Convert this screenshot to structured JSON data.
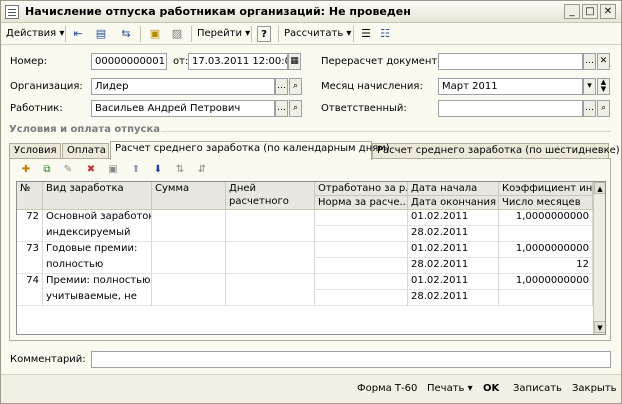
{
  "window": {
    "title": "Начисление отпуска работникам организаций: Не проведен"
  },
  "toolbar": {
    "actions_label": "Действия",
    "goto_label": "Перейти",
    "help_label": "?",
    "calculate_label": "Рассчитать"
  },
  "form": {
    "number_label": "Номер:",
    "number_value": "00000000001",
    "from_label": "от:",
    "date_value": "17.03.2011 12:00:00",
    "recalc_label": "Перерасчет документа:",
    "recalc_value": "",
    "org_label": "Организация:",
    "org_value": "Лидер",
    "month_label": "Месяц начисления:",
    "month_value": "Март 2011",
    "employee_label": "Работник:",
    "employee_value": "Васильев Андрей Петрович",
    "responsible_label": "Ответственный:",
    "responsible_value": "",
    "comment_label": "Комментарий:",
    "comment_value": ""
  },
  "section_title": "Условия и оплата отпуска",
  "tabs": [
    {
      "label": "Условия"
    },
    {
      "label": "Оплата"
    },
    {
      "label": "Расчет среднего заработка (по календарным дням)"
    },
    {
      "label": "Расчет среднего заработка (по шестидневке)"
    }
  ],
  "grid": {
    "columns": {
      "n": "№",
      "type": "Вид заработка",
      "sum": "Сумма",
      "days": "Дней расчетного периода",
      "worked": "Отработано за р...",
      "norm": "Норма за расче...",
      "start": "Дата начала",
      "end": "Дата окончания",
      "coef": "Коэффициент ин...",
      "months": "Число месяцев"
    },
    "rows": [
      {
        "n": "72",
        "type1": "Основной заработок:",
        "type2": "индексируемый",
        "start": "01.02.2011",
        "end": "28.02.2011",
        "coef": "1,0000000000",
        "months": ""
      },
      {
        "n": "73",
        "type1": "Годовые премии:",
        "type2": "полностью",
        "start": "01.02.2011",
        "end": "28.02.2011",
        "coef": "1,0000000000",
        "months": "12"
      },
      {
        "n": "74",
        "type1": "Премии: полностью",
        "type2": "учитываемые, не",
        "start": "01.02.2011",
        "end": "28.02.2011",
        "coef": "1,0000000000",
        "months": ""
      }
    ]
  },
  "footer": {
    "form_t60": "Форма Т-60",
    "print_label": "Печать",
    "ok_label": "OK",
    "save_label": "Записать",
    "close_label": "Закрыть"
  }
}
